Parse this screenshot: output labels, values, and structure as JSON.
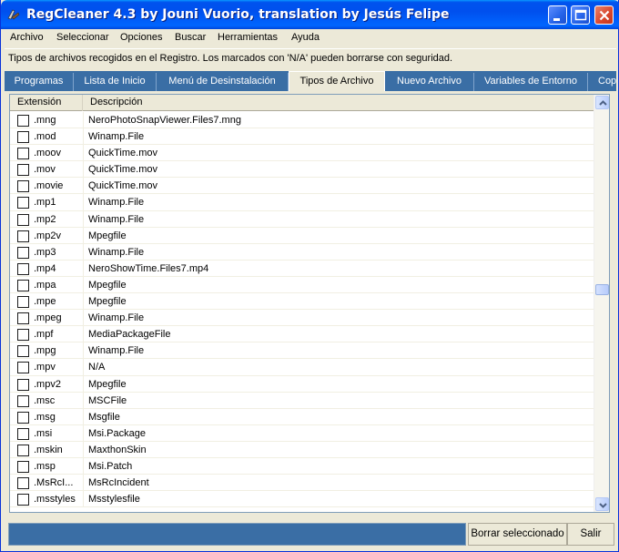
{
  "window": {
    "title": "RegCleaner 4.3 by Jouni Vuorio, translation by Jesús Felipe"
  },
  "menu": [
    {
      "label": "Archivo"
    },
    {
      "label": "Seleccionar"
    },
    {
      "label": "Opciones"
    },
    {
      "label": "Buscar"
    },
    {
      "label": "Herramientas"
    },
    {
      "label": "Ayuda"
    }
  ],
  "info": {
    "text": "Tipos de archivos recogidos en el Registro. Los marcados con 'N/A' pueden borrarse con seguridad."
  },
  "tabs": [
    {
      "label": "Programas"
    },
    {
      "label": "Lista de Inicio"
    },
    {
      "label": "Menú de Desinstalación"
    },
    {
      "label": "Tipos de Archivo"
    },
    {
      "label": "Nuevo Archivo"
    },
    {
      "label": "Variables de Entorno"
    },
    {
      "label": "Cop"
    }
  ],
  "active_tab": "Tipos de Archivo",
  "list": {
    "columns": [
      "Extensión",
      "Descripción"
    ],
    "rows": [
      {
        "ext": ".mng",
        "desc": "NeroPhotoSnapViewer.Files7.mng"
      },
      {
        "ext": ".mod",
        "desc": "Winamp.File"
      },
      {
        "ext": ".moov",
        "desc": "QuickTime.mov"
      },
      {
        "ext": ".mov",
        "desc": "QuickTime.mov"
      },
      {
        "ext": ".movie",
        "desc": "QuickTime.mov"
      },
      {
        "ext": ".mp1",
        "desc": "Winamp.File"
      },
      {
        "ext": ".mp2",
        "desc": "Winamp.File"
      },
      {
        "ext": ".mp2v",
        "desc": "Mpegfile"
      },
      {
        "ext": ".mp3",
        "desc": "Winamp.File"
      },
      {
        "ext": ".mp4",
        "desc": "NeroShowTime.Files7.mp4"
      },
      {
        "ext": ".mpa",
        "desc": "Mpegfile"
      },
      {
        "ext": ".mpe",
        "desc": "Mpegfile"
      },
      {
        "ext": ".mpeg",
        "desc": "Winamp.File"
      },
      {
        "ext": ".mpf",
        "desc": "MediaPackageFile"
      },
      {
        "ext": ".mpg",
        "desc": "Winamp.File"
      },
      {
        "ext": ".mpv",
        "desc": "N/A"
      },
      {
        "ext": ".mpv2",
        "desc": "Mpegfile"
      },
      {
        "ext": ".msc",
        "desc": "MSCFile"
      },
      {
        "ext": ".msg",
        "desc": "Msgfile"
      },
      {
        "ext": ".msi",
        "desc": "Msi.Package"
      },
      {
        "ext": ".mskin",
        "desc": "MaxthonSkin"
      },
      {
        "ext": ".msp",
        "desc": "Msi.Patch"
      },
      {
        "ext": ".MsRcI...",
        "desc": "MsRcIncident"
      },
      {
        "ext": ".msstyles",
        "desc": "Msstylesfile"
      }
    ]
  },
  "scroll_position": 0.46,
  "buttons": {
    "delete_selected": "Borrar seleccionado",
    "exit": "Salir"
  },
  "colors": {
    "accent": "#3A6EA5",
    "titlebar": "#0054E3"
  }
}
